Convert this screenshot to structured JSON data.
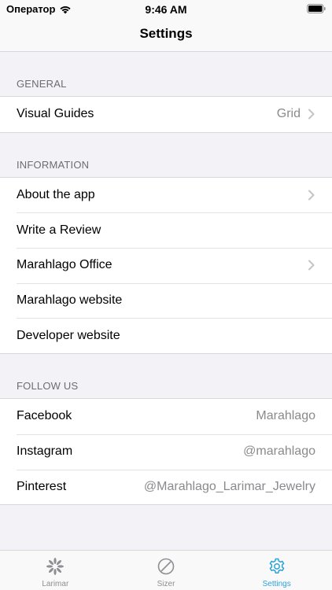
{
  "status_bar": {
    "carrier": "Оператор",
    "time": "9:46 AM"
  },
  "nav": {
    "title": "Settings"
  },
  "sections": [
    {
      "header": "GENERAL",
      "rows": [
        {
          "label": "Visual Guides",
          "detail": "Grid",
          "chevron": true
        }
      ]
    },
    {
      "header": "INFORMATION",
      "rows": [
        {
          "label": "About the app",
          "detail": "",
          "chevron": true
        },
        {
          "label": "Write a Review",
          "detail": "",
          "chevron": false
        },
        {
          "label": "Marahlago Office",
          "detail": "",
          "chevron": true
        },
        {
          "label": "Marahlago website",
          "detail": "",
          "chevron": false
        },
        {
          "label": "Developer website",
          "detail": "",
          "chevron": false
        }
      ]
    },
    {
      "header": "FOLLOW US",
      "rows": [
        {
          "label": "Facebook",
          "detail": "Marahlago",
          "chevron": false
        },
        {
          "label": "Instagram",
          "detail": "@marahlago",
          "chevron": false
        },
        {
          "label": "Pinterest",
          "detail": "@Marahlago_Larimar_Jewelry",
          "chevron": false
        }
      ]
    }
  ],
  "tabbar": {
    "tabs": [
      {
        "label": "Larimar",
        "icon": "larimar-flower-icon",
        "active": false
      },
      {
        "label": "Sizer",
        "icon": "sizer-ring-icon",
        "active": false
      },
      {
        "label": "Settings",
        "icon": "gear-icon",
        "active": true
      }
    ]
  },
  "colors": {
    "accent": "#2aa4d8",
    "background": "#f2f2f7",
    "detail_text": "#8a8a8e"
  }
}
